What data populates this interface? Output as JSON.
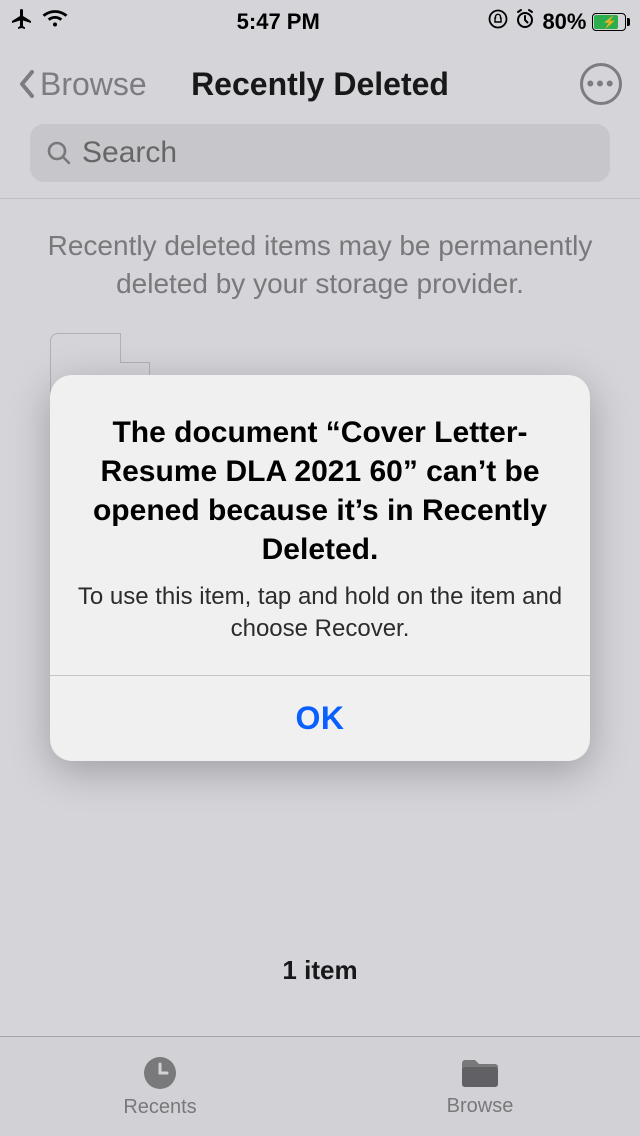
{
  "status": {
    "time": "5:47 PM",
    "battery_percent": "80%"
  },
  "nav": {
    "back_label": "Browse",
    "title": "Recently Deleted"
  },
  "search": {
    "placeholder": "Search"
  },
  "notice": "Recently deleted items may be permanently deleted by your storage provider.",
  "files": {
    "count_label": "1 item",
    "items": [
      {
        "name": "Cover Letter- Resume DLA 2021 60"
      }
    ]
  },
  "alert": {
    "title": "The document “Cover Letter- Resume DLA 2021 60” can’t be opened because it’s in Recently Deleted.",
    "message": "To use this item, tap and hold on the item and choose Recover.",
    "ok": "OK"
  },
  "tabs": {
    "recents": "Recents",
    "browse": "Browse"
  }
}
